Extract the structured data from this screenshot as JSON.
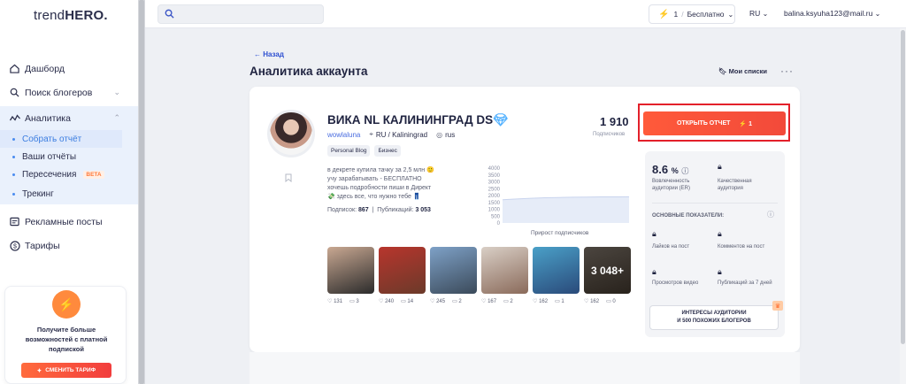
{
  "brand": {
    "logo_light": "trend",
    "logo_bold": "HERO",
    "logo_dot": "."
  },
  "sidebar": {
    "items": [
      {
        "label": "Дашборд",
        "icon": "home-icon"
      },
      {
        "label": "Поиск блогеров",
        "icon": "search-icon"
      },
      {
        "label": "Аналитика",
        "icon": "analytics-icon"
      },
      {
        "label": "Рекламные посты",
        "icon": "ads-icon"
      },
      {
        "label": "Тарифы",
        "icon": "dollar-icon"
      }
    ],
    "analytics_sub": [
      {
        "label": "Собрать отчёт",
        "active": true
      },
      {
        "label": "Ваши отчёты"
      },
      {
        "label": "Пересечения",
        "badge": "BETA"
      },
      {
        "label": "Трекинг"
      }
    ]
  },
  "upgrade": {
    "text": "Получите больше возможностей с платной подпиской",
    "button": "СМЕНИТЬ ТАРИФ"
  },
  "topbar": {
    "search_placeholder": "",
    "plan_count": "1",
    "plan_name": "Бесплатно",
    "lang": "RU",
    "email": "balina.ksyuha123@mail.ru"
  },
  "main": {
    "back": "Назад",
    "title": "Аналитика аккаунта",
    "my_lists": "Мои списки"
  },
  "account": {
    "name": "ВИКА NL КАЛИНИНГРАД DS",
    "handle": "wowlaluna",
    "geo": "RU / Kaliningrad",
    "lang": "rus",
    "tags": [
      "Personal Blog",
      "Бизнес"
    ],
    "followers": "1 910",
    "followers_label": "Подписчиков",
    "bio_lines": [
      "в декрете купила тачку за 2,5 млн 🙂",
      "учу зарабатывать - БЕСПЛАТНО",
      "хочешь подробности пиши в Директ",
      "💸 здесь все, что нужно тебе 👖"
    ],
    "following_label": "Подписок:",
    "following": "867",
    "posts_label": "Публикаций:",
    "posts_count": "3 053"
  },
  "chart_data": {
    "type": "area",
    "title": "",
    "xlabel": "Прирост подписчиков",
    "ylabel": "",
    "y_ticks": [
      0,
      500,
      1000,
      1500,
      2000,
      2500,
      3000,
      3500,
      4000
    ],
    "ylim": [
      0,
      4000
    ],
    "values": [
      1700,
      1750,
      1800,
      1840,
      1860,
      1880,
      1890,
      1900,
      1905,
      1910
    ]
  },
  "posts": [
    {
      "likes": "131",
      "comments": "3",
      "colors": [
        "#c9a892",
        "#2b2b2b"
      ]
    },
    {
      "likes": "240",
      "comments": "14",
      "colors": [
        "#b8352d",
        "#6b3a2a"
      ]
    },
    {
      "likes": "245",
      "comments": "2",
      "colors": [
        "#7ea1c7",
        "#3b4a5a"
      ]
    },
    {
      "likes": "167",
      "comments": "2",
      "colors": [
        "#d9cfc6",
        "#8a6a5a"
      ]
    },
    {
      "likes": "162",
      "comments": "1",
      "colors": [
        "#4aa0c8",
        "#2a4a7a"
      ]
    },
    {
      "likes": "162",
      "comments": "0",
      "colors": [
        "#8a7f74",
        "#4a3f34"
      ],
      "more": "3 048+"
    }
  ],
  "report": {
    "button": "ОТКРЫТЬ ОТЧЕТ",
    "cost": "1"
  },
  "metrics": {
    "er_value": "8.6",
    "er_unit": "%",
    "er_label": "Вовлеченность аудитории (ER)",
    "quality_label": "Качественная аудитория",
    "main_indicators": "ОСНОВНЫЕ ПОКАЗАТЕЛИ",
    "likes_label": "Лайков на пост",
    "comments_label": "Комментов на пост",
    "views_label": "Просмотров видео",
    "pubs_label": "Публикаций за 7 дней",
    "interests_line1": "ИНТЕРЕСЫ АУДИТОРИИ",
    "interests_line2": "И 500 ПОХОЖИХ БЛОГЕРОВ"
  },
  "colors": {
    "accent": "#3b55c6",
    "cta": "#f24a3a",
    "highlight": "#e3202a"
  }
}
